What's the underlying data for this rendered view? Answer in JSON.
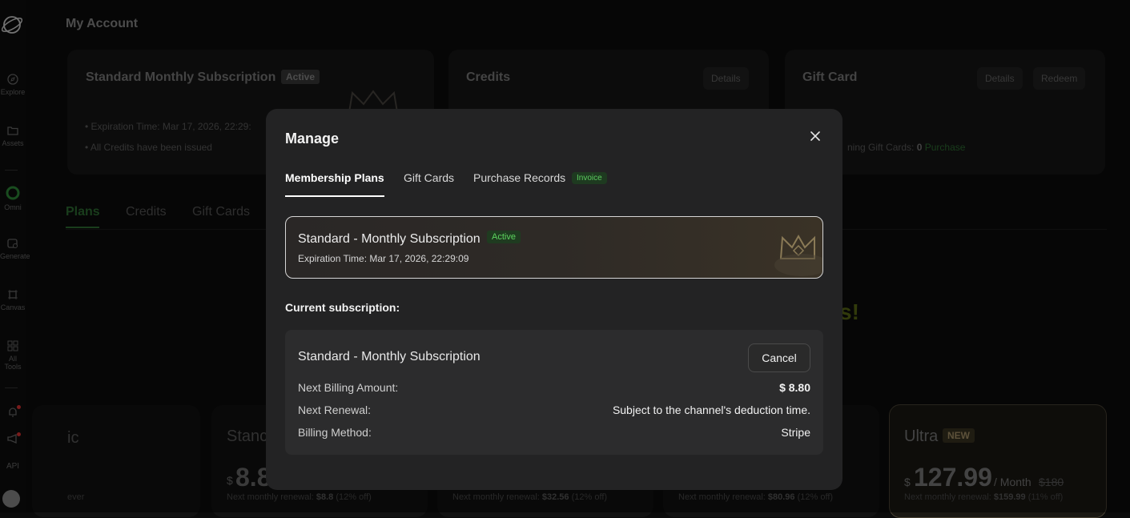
{
  "sidebar": {
    "items": [
      {
        "label": "Explore",
        "icon": "compass-icon"
      },
      {
        "label": "Assets",
        "icon": "folder-icon"
      },
      {
        "label": "Omni",
        "icon": "omni-icon"
      },
      {
        "label": "Generate",
        "icon": "generate-icon"
      },
      {
        "label": "Canvas",
        "icon": "canvas-icon"
      },
      {
        "label": "All Tools",
        "icon": "grid-icon"
      }
    ],
    "api_label": "API"
  },
  "page": {
    "title": "My Account",
    "subscription_card": {
      "title": "Standard Monthly Subscription",
      "badge": "Active",
      "expiration": "Expiration Time: Mar 17, 2026, 22:29:",
      "credits_note": "All Credits have been issued"
    },
    "credits_card": {
      "title": "Credits",
      "details_button": "Details"
    },
    "gift_card": {
      "title": "Gift Card",
      "details_button": "Details",
      "redeem_button": "Redeem",
      "remaining_label": "ning Gift Cards:",
      "remaining_count": "0",
      "purchase_link": "Purchase"
    },
    "tabs": [
      "Plans",
      "Credits",
      "Gift Cards"
    ],
    "headline_fragment": "s!",
    "plans": [
      {
        "name_fragment": "ic",
        "renewal_fragment": "ever"
      },
      {
        "name_fragment": "Stanc",
        "currency": "$",
        "price_fragment": "8.8",
        "renewal": "Next monthly renewal:",
        "renewal_price": "$8.8",
        "discount": "(12% off)"
      },
      {
        "renewal": "Next monthly renewal:",
        "renewal_price": "$32.56",
        "discount": "(12% off)"
      },
      {
        "renewal": "Next monthly renewal:",
        "renewal_price": "$80.96",
        "discount": "(12% off)"
      },
      {
        "name": "Ultra",
        "badge": "NEW",
        "currency": "$",
        "price": "127.99",
        "period": "/ Month",
        "original_price": "$180",
        "renewal": "Next monthly renewal:",
        "renewal_price": "$159.99",
        "discount": "(11% off)"
      }
    ]
  },
  "modal": {
    "title": "Manage",
    "tabs": [
      {
        "label": "Membership Plans",
        "active": true
      },
      {
        "label": "Gift Cards",
        "active": false
      },
      {
        "label": "Purchase Records",
        "active": false
      }
    ],
    "invoice_badge": "Invoice",
    "current_plan": {
      "name": "Standard - Monthly Subscription",
      "badge": "Active",
      "expiration": "Expiration Time: Mar 17, 2026, 22:29:09"
    },
    "section_label": "Current subscription:",
    "subscription": {
      "name": "Standard - Monthly Subscription",
      "cancel_button": "Cancel",
      "rows": [
        {
          "label": "Next Billing Amount:",
          "value": "$ 8.80"
        },
        {
          "label": "Next Renewal:",
          "value": "Subject to the channel's deduction time."
        },
        {
          "label": "Billing Method:",
          "value": "Stripe"
        }
      ]
    }
  },
  "colors": {
    "accent_green": "#4caf50",
    "badge_green": "#5cd45e",
    "modal_bg": "#232324"
  }
}
